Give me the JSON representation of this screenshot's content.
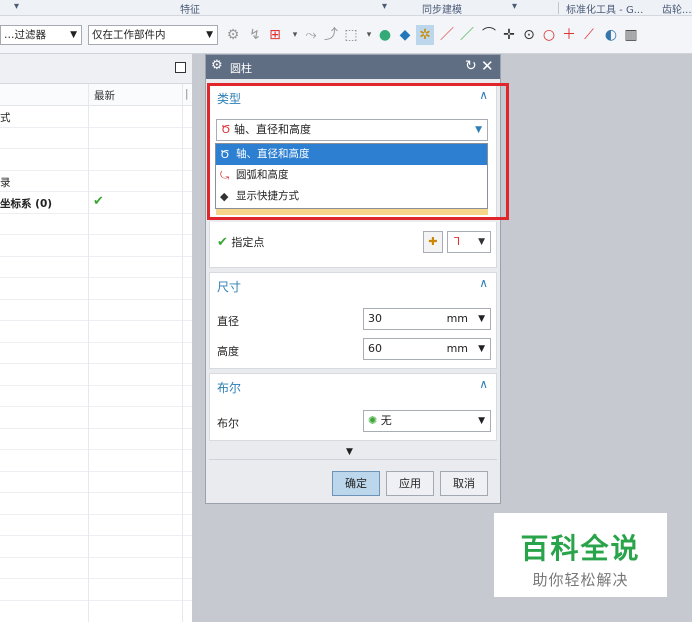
{
  "ribbon": {
    "group_feature": "特征",
    "group_sync": "同步建模",
    "group_standard": "标准化工具 - G...",
    "group_gear": "齿轮..."
  },
  "toolbar": {
    "filter_combo": "…过滤器",
    "scope_combo": "仅在工作部件内"
  },
  "navigator": {
    "column_latest": "最新",
    "rows": [
      {
        "name": "式",
        "check": ""
      },
      {
        "name": "",
        "check": ""
      },
      {
        "name": "",
        "check": ""
      },
      {
        "name": "录",
        "check": ""
      },
      {
        "name": "坐标系 (0)",
        "check": "✔"
      }
    ]
  },
  "dialog": {
    "title": "圆柱",
    "type_section": {
      "title": "类型",
      "selected": "轴、直径和高度",
      "options": [
        {
          "label": "轴、直径和高度",
          "icon": "axis-diameter-height-icon"
        },
        {
          "label": "圆弧和高度",
          "icon": "arc-height-icon"
        },
        {
          "label": "显示快捷方式",
          "icon": "show-shortcuts-icon"
        }
      ]
    },
    "point_label": "指定点",
    "dimension_section": {
      "title": "尺寸",
      "diameter_label": "直径",
      "diameter_value": "30",
      "diameter_unit": "mm",
      "height_label": "高度",
      "height_value": "60",
      "height_unit": "mm"
    },
    "boolean_section": {
      "title": "布尔",
      "label": "布尔",
      "value": "无"
    },
    "buttons": {
      "ok": "确定",
      "apply": "应用",
      "cancel": "取消"
    }
  },
  "watermark": {
    "line1": "百科全说",
    "line2": "助你轻松解决"
  },
  "colors": {
    "highlight": "#e0252b",
    "accent": "#2d7fb5",
    "selection": "#2d7fd2",
    "watermark": "#2aa44a"
  }
}
